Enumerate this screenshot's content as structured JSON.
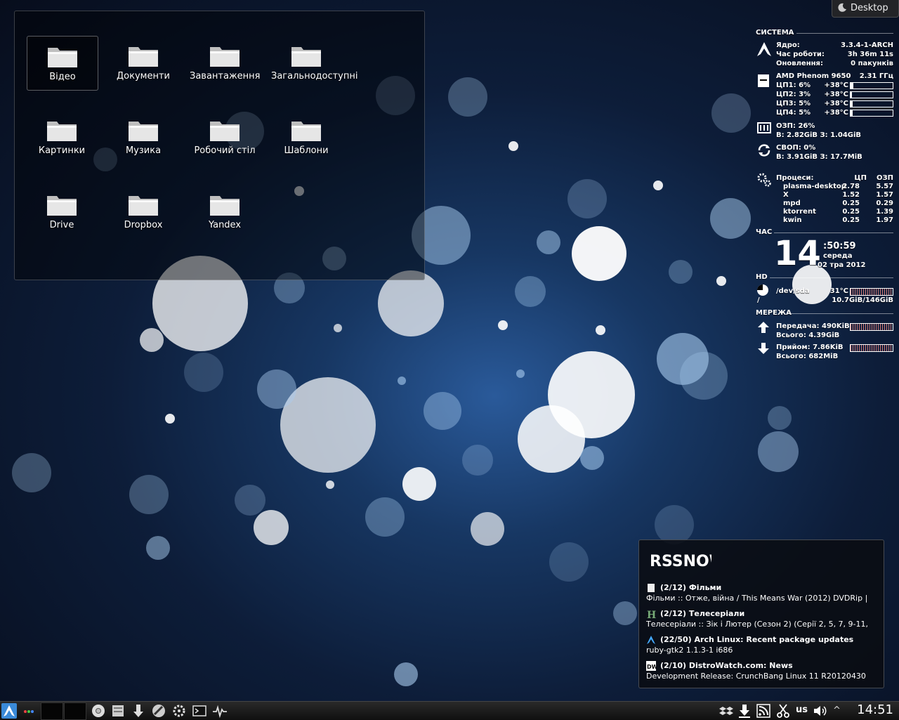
{
  "activity_button": {
    "label": "Desktop"
  },
  "folder_view": {
    "items": [
      {
        "label": "Відео",
        "selected": true
      },
      {
        "label": "Документи"
      },
      {
        "label": "Завантаження"
      },
      {
        "label": "Загальнодоступні"
      },
      {
        "label": "Картинки"
      },
      {
        "label": "Музика"
      },
      {
        "label": "Робочий стіл"
      },
      {
        "label": "Шаблони"
      },
      {
        "label": "Drive"
      },
      {
        "label": "Dropbox"
      },
      {
        "label": "Yandex"
      }
    ]
  },
  "conky": {
    "system": {
      "header": "СИСТЕМА",
      "kernel_label": "Ядро:",
      "kernel": "3.3.4-1-ARCH",
      "uptime_label": "Час роботи:",
      "uptime": "3h 36m 11s",
      "updates_label": "Оновлення:",
      "updates": "0 пакунків"
    },
    "cpu": {
      "model": "AMD Phenom 9650",
      "freq": "2.31 ГГц",
      "cores": [
        {
          "label": "ЦП1: 6%",
          "temp": "+38°C",
          "usage": 0.06
        },
        {
          "label": "ЦП2: 3%",
          "temp": "+38°C",
          "usage": 0.03
        },
        {
          "label": "ЦП3: 5%",
          "temp": "+38°C",
          "usage": 0.05
        },
        {
          "label": "ЦП4: 5%",
          "temp": "+38°C",
          "usage": 0.05
        }
      ]
    },
    "ram": {
      "line1": "ОЗП: 26%",
      "line2": "В: 2.82GiB З: 1.04GiB"
    },
    "swap": {
      "line1": "СВОП: 0%",
      "line2": "В: 3.91GiB З: 17.7MiB"
    },
    "processes": {
      "label": "Процеси:",
      "col_cpu": "ЦП",
      "col_mem": "ОЗП",
      "rows": [
        {
          "name": "plasma-desktop",
          "cpu": "2.78",
          "mem": "5.57"
        },
        {
          "name": "X",
          "cpu": "1.52",
          "mem": "1.57"
        },
        {
          "name": "mpd",
          "cpu": "0.25",
          "mem": "0.29"
        },
        {
          "name": "ktorrent",
          "cpu": "0.25",
          "mem": "1.39"
        },
        {
          "name": "kwin",
          "cpu": "0.25",
          "mem": "1.97"
        }
      ]
    },
    "time": {
      "header": "ЧАС",
      "hour": "14",
      "min_sec": ":50:59",
      "weekday": "середа",
      "date": "02 тра 2012"
    },
    "hd": {
      "header": "HD",
      "device": "/dev/sda",
      "temp": "31°C",
      "mount": "/",
      "usage": "10.7GiB/146GiB"
    },
    "network": {
      "header": "МЕРЕЖА",
      "up_rate": "Передача: 490KiB",
      "up_total": "Всього: 4.39GiB",
      "down_rate": "Прийом: 7.86KiB",
      "down_total": "Всього: 682MiB"
    }
  },
  "rss": {
    "title": "RSSNOW",
    "items": [
      {
        "title": "(2/12) Фільми",
        "desc": "Фільми :: Отже, війна / This Means War (2012) DVDRip |",
        "icon": "page-icon"
      },
      {
        "title": "(2/12) Телесеріали",
        "desc": "Телесеріали :: Зік і Лютер (Сезон 2) (Серії 2, 5, 7, 9-11,",
        "icon": "h-logo-icon"
      },
      {
        "title": "(22/50) Arch Linux: Recent package updates",
        "desc": "ruby-gtk2 1.1.3-1 i686",
        "icon": "arch-logo-icon"
      },
      {
        "title": "(2/10) DistroWatch.com: News",
        "desc": "Development Release: CrunchBang Linux 11 R20120430",
        "icon": "distrowatch-icon"
      }
    ]
  },
  "taskbar": {
    "keyboard_layout": "us",
    "clock": "14:51",
    "launchers": [
      "app-launcher-icon",
      "dots-icon",
      "chrome-icon",
      "files-icon",
      "download-icon",
      "disk-utility-icon",
      "settings-icon",
      "terminal-icon",
      "system-monitor-icon"
    ],
    "tray": [
      "dropbox-icon",
      "download-icon",
      "rss-icon",
      "scissors-icon",
      "volume-icon"
    ]
  }
}
